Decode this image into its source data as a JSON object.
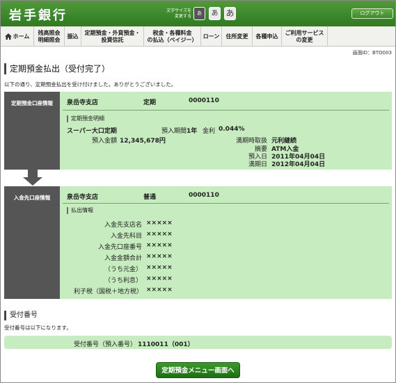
{
  "header": {
    "bank_name": "岩手銀行",
    "font_size_label": "文字サイズを 変更する",
    "font_buttons": [
      "あ",
      "あ",
      "あ"
    ],
    "logout": "ログアウト"
  },
  "nav": {
    "items": [
      {
        "label": "ホーム",
        "icon": "home-icon"
      },
      {
        "label": "残高照会\n明細照会"
      },
      {
        "label": "振込"
      },
      {
        "label": "定期預金・外貨預金・\n投資信託"
      },
      {
        "label": "税金・各種料金\nの払込（ペイジー）"
      },
      {
        "label": "ローン"
      },
      {
        "label": "住所変更"
      },
      {
        "label": "各種申込"
      },
      {
        "label": "ご利用サービス\nの変更"
      }
    ]
  },
  "screen_id": "画面ID：BTO003",
  "page_title": "定期預金払出（受付完了）",
  "intro": "以下の通り、定期預金払出を受け付けました。ありがとうございました。",
  "source_account": {
    "side_label": "定期預金口座情報",
    "branch": "泉岳寺支店",
    "type": "定期",
    "number": "0000110",
    "detail_heading": "定期預金明細",
    "product": "スーパー大口定期",
    "term_label": "預入期間",
    "term": "1年",
    "rate_label": "金利",
    "rate": "0.044%",
    "amount_label": "預入金額",
    "amount": "12,345,678円",
    "maturity_method_label": "満期時取扱",
    "maturity_method": "元利継続",
    "summary_label": "摘要",
    "summary": "ATM入金",
    "deposit_date_label": "預入日",
    "deposit_date": "2011年04月04日",
    "maturity_date_label": "満期日",
    "maturity_date": "2012年04月04日"
  },
  "dest_account": {
    "side_label": "入金先口座情報",
    "branch": "泉岳寺支店",
    "type": "普通",
    "number": "0000110",
    "detail_heading": "払出情報",
    "rows": [
      {
        "label": "入金先支店名",
        "value": "×××××"
      },
      {
        "label": "入金先科目",
        "value": "×××××"
      },
      {
        "label": "入金先口座番号",
        "value": "×××××"
      },
      {
        "label": "入金金額合計",
        "value": "×××××"
      },
      {
        "label": "（うち元金）",
        "value": "×××××"
      },
      {
        "label": "（うち利息）",
        "value": "×××××"
      },
      {
        "label": "利子税（国税＋地方税）",
        "value": "×××××"
      }
    ]
  },
  "receipt": {
    "heading": "受付番号",
    "intro": "受付番号は以下になります。",
    "label": "受付番号（預入番号）",
    "value": "1110011（001）"
  },
  "menu_button": "定期預金メニュー画面へ",
  "colors": {
    "header_green": "#3a8a2a",
    "panel_green": "#c7ecbf",
    "side_gray": "#555555"
  }
}
